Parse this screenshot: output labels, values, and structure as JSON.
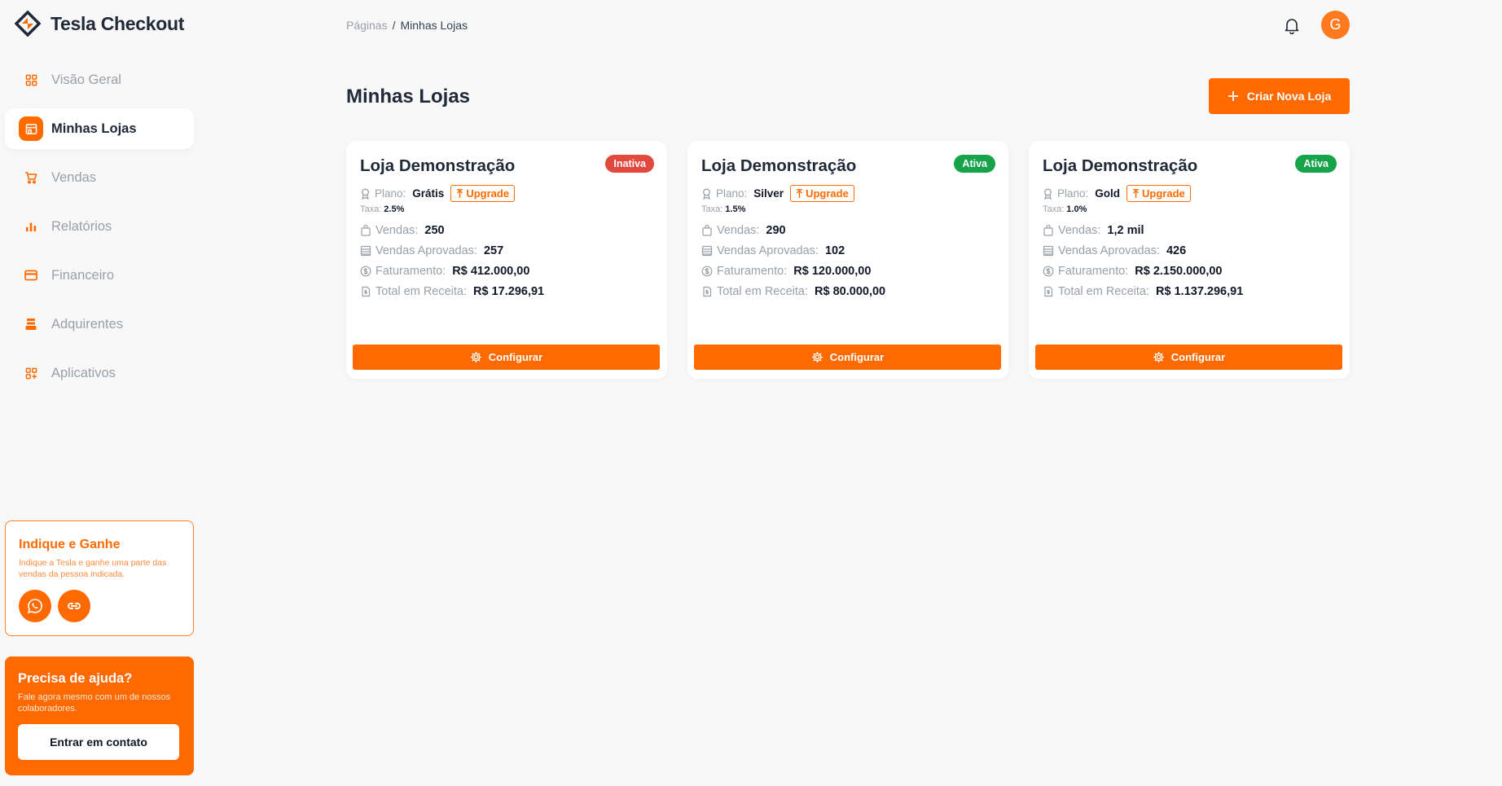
{
  "brand": {
    "name": "Tesla Checkout",
    "accent": "#ff6a00"
  },
  "sidebar": {
    "items": [
      {
        "label": "Visão Geral",
        "icon": "grid-icon"
      },
      {
        "label": "Minhas Lojas",
        "icon": "store-icon",
        "active": true
      },
      {
        "label": "Vendas",
        "icon": "cart-icon"
      },
      {
        "label": "Relatórios",
        "icon": "bar-chart-icon"
      },
      {
        "label": "Financeiro",
        "icon": "credit-card-icon"
      },
      {
        "label": "Adquirentes",
        "icon": "stack-icon"
      },
      {
        "label": "Aplicativos",
        "icon": "apps-icon"
      }
    ]
  },
  "refer": {
    "title": "Indique e Ganhe",
    "text": "Indique a Tesla e ganhe uma parte das vendas da pessoa indicada."
  },
  "help": {
    "title": "Precisa de ajuda?",
    "text": "Fale agora mesmo com um de nossos colaboradores.",
    "button": "Entrar em contato"
  },
  "header": {
    "breadcrumb_root": "Páginas",
    "breadcrumb_sep": "/",
    "breadcrumb_current": "Minhas Lojas",
    "avatar_initial": "G"
  },
  "main": {
    "title": "Minhas Lojas",
    "create_button": "Criar Nova Loja"
  },
  "labels": {
    "plan": "Plano:",
    "upgrade": "Upgrade",
    "tax": "Taxa:",
    "sales": "Vendas:",
    "approved": "Vendas Aprovadas:",
    "revenue": "Faturamento:",
    "total": "Total em Receita:",
    "configure": "Configurar"
  },
  "stores": [
    {
      "name": "Loja Demonstração",
      "status": "Inativa",
      "status_color": "#e0493b",
      "plan": "Grátis",
      "tax": "2.5%",
      "sales": "250",
      "approved": "257",
      "revenue": "R$ 412.000,00",
      "total": "R$ 17.296,91"
    },
    {
      "name": "Loja Demonstração",
      "status": "Ativa",
      "status_color": "#16a34a",
      "plan": "Silver",
      "tax": "1.5%",
      "sales": "290",
      "approved": "102",
      "revenue": "R$ 120.000,00",
      "total": "R$ 80.000,00"
    },
    {
      "name": "Loja Demonstração",
      "status": "Ativa",
      "status_color": "#16a34a",
      "plan": "Gold",
      "tax": "1.0%",
      "sales": "1,2 mil",
      "approved": "426",
      "revenue": "R$ 2.150.000,00",
      "total": "R$ 1.137.296,91"
    }
  ]
}
